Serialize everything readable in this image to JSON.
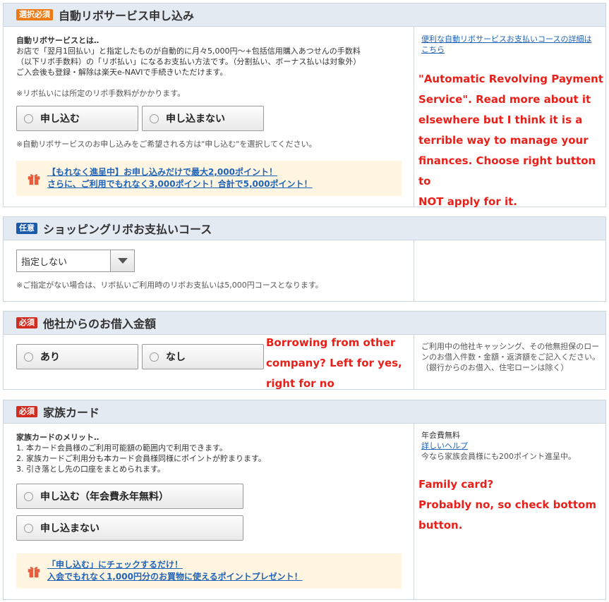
{
  "sections": {
    "revo": {
      "badge": "選択必須",
      "title": "自動リボサービス申し込み",
      "intro_heading": "自動リボサービスとは‥",
      "intro_lines": [
        "お店で「翌月1回払い」と指定したものが自動的に月々5,000円〜+包括信用購入あつせんの手数料",
        "（以下リボ手数料）の「リボ払い」になるお支払い方法です。（分割払い、ボーナス払いは対象外）",
        "ご入会後も登録・解除は楽天e-NAVIで手続きいただけます。"
      ],
      "fee_note": "※リボ払いには所定のリボ手数料がかかります。",
      "options": [
        "申し込む",
        "申し込まない"
      ],
      "choice_note": "※自動リボサービスのお申し込みをご希望される方は\"申し込む\"を選択してください。",
      "promo_lines": [
        "【もれなく進呈中】お申し込みだけで最大2,000ポイント！",
        "さらに、ご利用でもれなく3,000ポイント！合計で5,000ポイント！"
      ],
      "side_link": "便利な自動リボサービスお支払いコースの詳細はこちら",
      "annotation_lines": [
        "\"Automatic Revolving Payment",
        "Service\". Read more about it",
        "elsewhere but I think it is a",
        "terrible way to manage your",
        "finances. Choose right button to",
        "NOT apply for it."
      ]
    },
    "course": {
      "badge": "任意",
      "title": "ショッピングリボお支払いコース",
      "select_value": "指定しない",
      "note": "※ご指定がない場合は、リボ払いご利用時のリボお支払いは5,000円コースとなります。"
    },
    "borrow": {
      "badge": "必須",
      "title": "他社からのお借入金額",
      "options": [
        "あり",
        "なし"
      ],
      "annotation_lines": [
        "Borrowing from other",
        "company? Left for yes,",
        "right for no"
      ],
      "side_lines": [
        "ご利用中の他社キャッシング、その他無担保のロー",
        "ンのお借入件数・金額・返済額をご記入ください。",
        "（銀行からのお借入、住宅ローンは除く）"
      ]
    },
    "family": {
      "badge": "必須",
      "title": "家族カード",
      "merit_heading": "家族カードのメリット‥",
      "merits": [
        "1. 本カード会員様のご利用可能額の範囲内で利用できます。",
        "2. 家族カードご利用分も本カード会員様同様にポイントが貯まります。",
        "3. 引き落とし先の口座をまとめられます。"
      ],
      "options": [
        "申し込む（年会費永年無料）",
        "申し込まない"
      ],
      "promo_lines": [
        "「申し込む」にチェックするだけ！",
        "入会でもれなく1,000円分のお買物に使えるポイントプレゼント！"
      ],
      "side_fee": "年会費無料",
      "side_link": "詳しいヘルプ",
      "side_note": "今なら家族会員様にも200ポイント進呈中。",
      "annotation_lines": [
        "Family card?",
        "Probably no, so check bottom",
        "button."
      ]
    }
  },
  "colors": {
    "accent_link": "#1f63b8",
    "annotation": "#e8201a",
    "header_bg": "#e4eaf2",
    "promo_bg": "#fff5e0"
  }
}
